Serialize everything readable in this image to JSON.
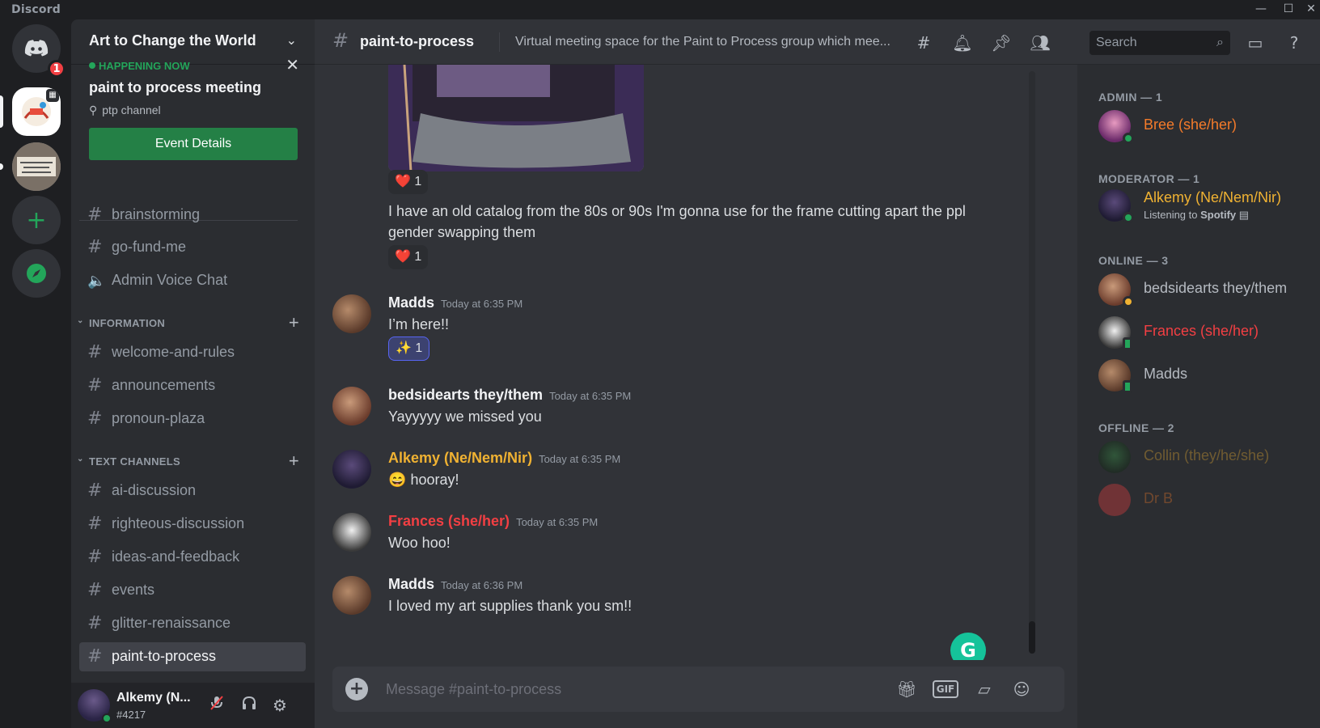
{
  "app": {
    "brand": "Discord",
    "window_controls": [
      "—",
      "☐",
      "✕"
    ]
  },
  "rail": {
    "home_badge": "1"
  },
  "guild": {
    "name": "Art to Change the World",
    "event": {
      "status": "HAPPENING NOW",
      "title": "paint to process meeting",
      "location": "ptp channel",
      "button": "Event Details"
    },
    "top_channels": [
      {
        "name": "brainstorming",
        "type": "text"
      },
      {
        "name": "go-fund-me",
        "type": "text"
      },
      {
        "name": "Admin Voice Chat",
        "type": "voice"
      }
    ],
    "categories": [
      {
        "name": "INFORMATION",
        "channels": [
          "welcome-and-rules",
          "announcements",
          "pronoun-plaza"
        ]
      },
      {
        "name": "TEXT CHANNELS",
        "channels": [
          "ai-discussion",
          "righteous-discussion",
          "ideas-and-feedback",
          "events",
          "glitter-renaissance",
          "paint-to-process"
        ]
      }
    ]
  },
  "user": {
    "name": "Alkemy (N...",
    "tag": "#4217"
  },
  "channel": {
    "name": "paint-to-process",
    "topic": "Virtual meeting space for the Paint to Process group which mee...",
    "search_placeholder": "Search",
    "composer_placeholder": "Message #paint-to-process"
  },
  "messages": {
    "reaction_img": {
      "emoji": "❤️",
      "count": "1"
    },
    "continued_text": "I have an old catalog from the 80s or 90s I'm gonna use for the frame cutting apart the ppl gender swapping them",
    "reaction_text": {
      "emoji": "❤️",
      "count": "1"
    },
    "items": [
      {
        "author": "Madds",
        "time": "Today at 6:35 PM",
        "text": "I’m here!!",
        "color": "#f2f3f5",
        "reaction": {
          "emoji": "✨",
          "count": "1"
        }
      },
      {
        "author": "bedsidearts they/them",
        "time": "Today at 6:35 PM",
        "text": "Yayyyyy we missed you",
        "color": "#f2f3f5"
      },
      {
        "author": "Alkemy (Ne/Nem/Nir)",
        "time": "Today at 6:35 PM",
        "text": "hooray!",
        "emoji": "😄",
        "color": "#f0b232"
      },
      {
        "author": "Frances (she/her)",
        "time": "Today at 6:35 PM",
        "text": "Woo hoo!",
        "color": "#f23f43"
      },
      {
        "author": "Madds",
        "time": "Today at 6:36 PM",
        "text": "I loved my art supplies thank you sm!!",
        "color": "#f2f3f5"
      }
    ]
  },
  "members": {
    "groups": [
      {
        "label": "ADMIN — 1"
      },
      {
        "label": "MODERATOR — 1"
      },
      {
        "label": "ONLINE — 3"
      },
      {
        "label": "OFFLINE — 2"
      }
    ],
    "list": [
      {
        "name": "Bree (she/her)",
        "color": "#f47b2a",
        "status": "online"
      },
      {
        "name": "Alkemy (Ne/Nem/Nir)",
        "color": "#f0b232",
        "status": "online",
        "activity_prefix": "Listening to ",
        "activity": "Spotify"
      },
      {
        "name": "bedsidearts they/them",
        "color": "#b5bac1",
        "status": "idle"
      },
      {
        "name": "Frances (she/her)",
        "color": "#f23f43",
        "status": "mobile"
      },
      {
        "name": "Madds",
        "color": "#b5bac1",
        "status": "mobile"
      },
      {
        "name": "Collin (they/he/she)",
        "color": "#f0b232",
        "status": "offline"
      },
      {
        "name": "Dr B",
        "color": "#f47b2a",
        "status": "offline"
      }
    ]
  },
  "grammarly": "G"
}
